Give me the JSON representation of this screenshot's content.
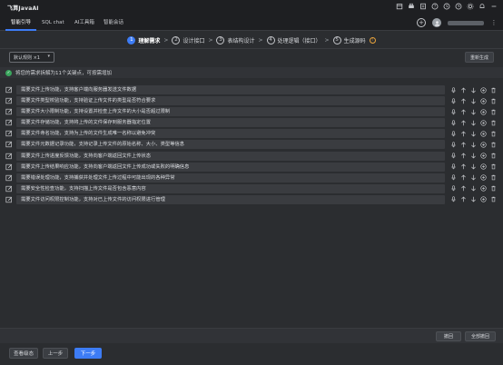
{
  "app": {
    "title": "飞算JavaAI"
  },
  "tabs": [
    {
      "label": "智能引导",
      "active": true
    },
    {
      "label": "SQL chat",
      "active": false
    },
    {
      "label": "AI工具箱",
      "active": false
    },
    {
      "label": "智能会话",
      "active": false
    }
  ],
  "stepper": {
    "steps": [
      {
        "num": "1",
        "label": "理解需求",
        "active": true
      },
      {
        "num": "2",
        "label": "设计接口",
        "active": false
      },
      {
        "num": "3",
        "label": "表结构设计",
        "active": false
      },
      {
        "num": "4",
        "label": "处理逻辑（接口）",
        "active": false
      },
      {
        "num": "5",
        "label": "生成源码",
        "active": false
      }
    ],
    "separator": ">"
  },
  "toolbar": {
    "rule_select": "默认规则 ×1",
    "regenerate_label": "重新生成"
  },
  "info": {
    "text": "将您的需求拆解为11个关键点，可按需增加"
  },
  "requirements": [
    "需要文件上传功能，支持客户端向服务器发送文件数据",
    "需要文件类型校验功能，支持验证上传文件的类型是否符合要求",
    "需要文件大小限制功能，支持设置并检查上传文件的大小是否超过限制",
    "需要文件存储功能，支持将上传的文件保存到服务器指定位置",
    "需要文件命名功能，支持为上传的文件生成唯一名称以避免冲突",
    "需要文件元数据记录功能，支持记录上传文件的原始名称、大小、类型等信息",
    "需要文件上传进度反馈功能，支持向客户端返回文件上传状态",
    "需要文件上传结果响应功能，支持向客户端返回文件上传成功或失败的明确信息",
    "需要错误处理功能，支持捕获并处理文件上传过程中可能出现的各种异常",
    "需要安全性检查功能，支持扫描上传文件是否包含恶意内容",
    "需要文件访问权限控制功能，支持对已上传文件的访问权限进行管理"
  ],
  "bottom": {
    "undo_label": "撤回",
    "undo_all_label": "全部撤回"
  },
  "footer": {
    "view_history_label": "查看级态",
    "prev_label": "上一步",
    "next_label": "下一步"
  },
  "colors": {
    "accent": "#3d7cf5",
    "success": "#3aa55d",
    "warning": "#e8a33d",
    "background": "#2b2d30"
  }
}
